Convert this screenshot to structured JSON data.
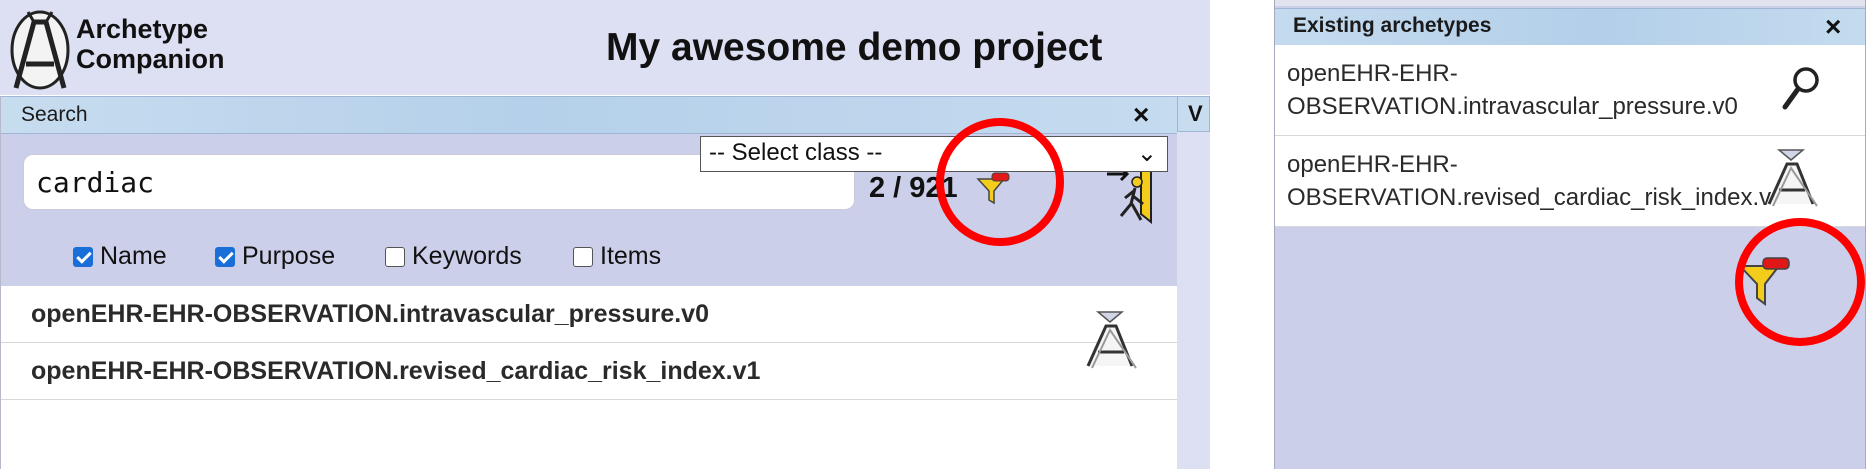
{
  "app": {
    "logo_line1": "Archetype",
    "logo_line2": "Companion",
    "project_title": "My awesome demo project"
  },
  "search_panel": {
    "title": "Search",
    "close_label": "×",
    "query": "cardiac",
    "match_count": "2 / 921",
    "filter_icon": "filter-icon",
    "exit_icon": "exit-icon",
    "checkboxes": [
      {
        "label": "Name",
        "checked": true
      },
      {
        "label": "Purpose",
        "checked": true
      },
      {
        "label": "Keywords",
        "checked": false
      },
      {
        "label": "Items",
        "checked": false
      }
    ],
    "select_class": "-- Select class --",
    "results": [
      "openEHR-EHR-OBSERVATION.intravascular_pressure.v0",
      "openEHR-EHR-OBSERVATION.revised_cardiac_risk_index.v1"
    ],
    "side_tab_label": "V"
  },
  "existing_panel": {
    "title": "Existing archetypes",
    "close_label": "×",
    "items": [
      {
        "text": "openEHR-EHR-\nOBSERVATION.intravascular_pressure.v0",
        "icon": "magnifier-icon"
      },
      {
        "text": "openEHR-EHR-\nOBSERVATION.revised_cardiac_risk_index.v",
        "icon": "archetype-import-icon"
      }
    ],
    "filter_icon": "filter-icon"
  },
  "colors": {
    "highlight_circle": "#ff0000",
    "panel_bg": "#cccfe9",
    "header_bg": "#dde0f3",
    "checkbox_on": "#1a6ed8"
  }
}
